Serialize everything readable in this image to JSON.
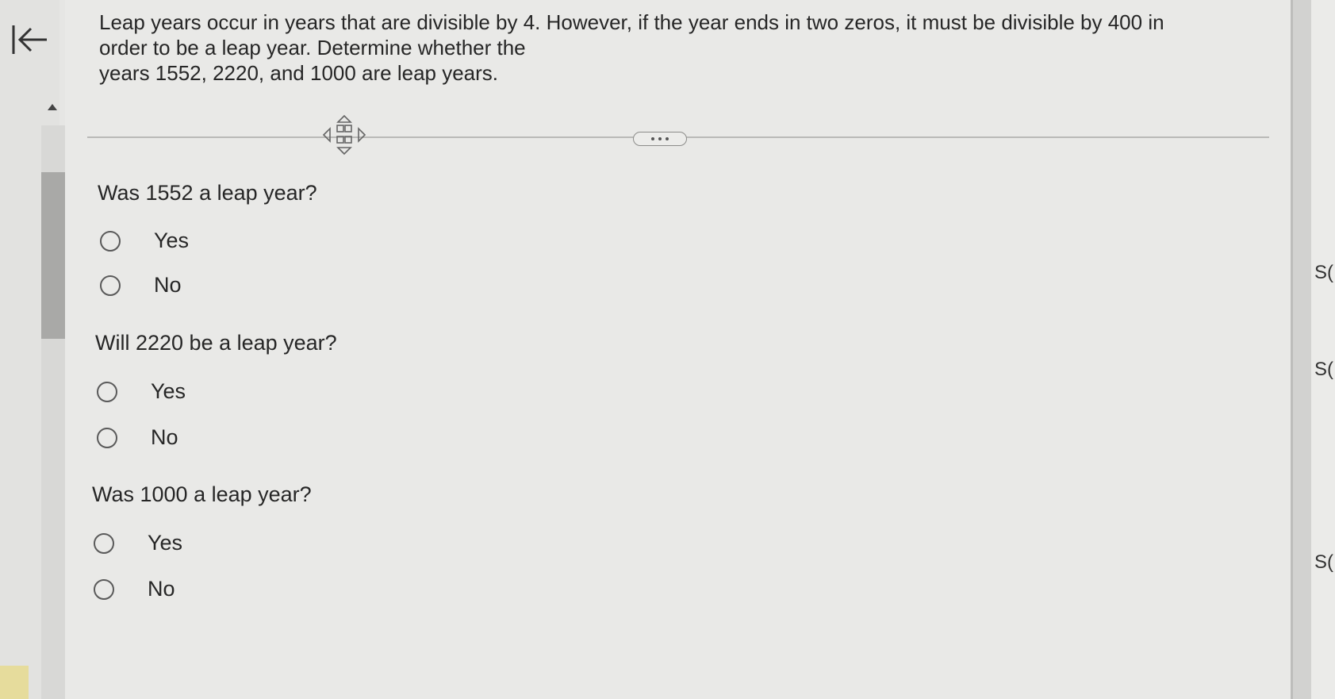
{
  "prompt": {
    "line1": "Leap years occur in years that are divisible by 4. However, if the year ends in two zeros, it must be divisible by 400 in",
    "line2": "order to be a leap year. Determine whether the",
    "line3": "years 1552, 2220, and 1000 are leap years."
  },
  "icons": {
    "back": "collapse-left-icon",
    "scroll_up": "triangle-up-icon",
    "move": "move-arrows-icon",
    "more": "ellipsis-icon"
  },
  "questions": [
    {
      "text": "Was 1552 a leap year?",
      "options": [
        {
          "label": "Yes"
        },
        {
          "label": "No"
        }
      ]
    },
    {
      "text": "Will 2220 be a leap year?",
      "options": [
        {
          "label": "Yes"
        },
        {
          "label": "No"
        }
      ]
    },
    {
      "text": "Was 1000 a leap year?",
      "options": [
        {
          "label": "Yes"
        },
        {
          "label": "No"
        }
      ]
    }
  ],
  "right_strip": {
    "labels": [
      "S(",
      "S(",
      "S("
    ]
  },
  "colors": {
    "background": "#e9e9e7",
    "text": "#262626",
    "radio_border": "#5a5a5a"
  }
}
